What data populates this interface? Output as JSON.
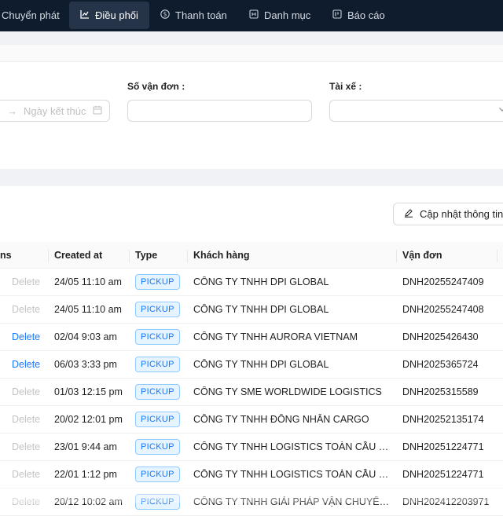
{
  "nav": {
    "items": [
      {
        "label": "Chuyển phát",
        "icon": "",
        "active": false
      },
      {
        "label": "Điều phối",
        "icon": "dispatch-chart-icon",
        "active": true
      },
      {
        "label": "Thanh toán",
        "icon": "dollar-icon",
        "active": false
      },
      {
        "label": "Danh mục",
        "icon": "catalog-icon",
        "active": false
      },
      {
        "label": "Báo cáo",
        "icon": "report-icon",
        "active": false
      }
    ]
  },
  "filters": {
    "date_end_placeholder": "Ngày kết thúc",
    "waybill_label": "Số vận đơn :",
    "driver_label": "Tài xế :"
  },
  "toolbar": {
    "update_label": "Cập nhật thông tin"
  },
  "table": {
    "headers": {
      "actions": "ns",
      "created_at": "Created at",
      "type": "Type",
      "customer": "Khách hàng",
      "waybill": "Vận đơn"
    },
    "delete_label": "Delete",
    "rows": [
      {
        "created_at": "24/05 11:10 am",
        "type": "PICKUP",
        "customer": "CÔNG TY TNHH DPI GLOBAL",
        "waybill": "DNH20255247409",
        "delete_enabled": false
      },
      {
        "created_at": "24/05 11:10 am",
        "type": "PICKUP",
        "customer": "CÔNG TY TNHH DPI GLOBAL",
        "waybill": "DNH20255247408",
        "delete_enabled": false
      },
      {
        "created_at": "02/04 9:03 am",
        "type": "PICKUP",
        "customer": "CÔNG TY TNHH AURORA VIETNAM",
        "waybill": "DNH2025426430",
        "delete_enabled": true
      },
      {
        "created_at": "06/03 3:33 pm",
        "type": "PICKUP",
        "customer": "CÔNG TY TNHH DPI GLOBAL",
        "waybill": "DNH2025365724",
        "delete_enabled": true
      },
      {
        "created_at": "01/03 12:15 pm",
        "type": "PICKUP",
        "customer": "CÔNG TY SME WORLDWIDE LOGISTICS",
        "waybill": "DNH2025315589",
        "delete_enabled": false
      },
      {
        "created_at": "20/02 12:01 pm",
        "type": "PICKUP",
        "customer": "CÔNG TY TNHH ĐÔNG NHÂN CARGO",
        "waybill": "DNH20252135174",
        "delete_enabled": false
      },
      {
        "created_at": "23/01 9:44 am",
        "type": "PICKUP",
        "customer": "CÔNG TY TNHH LOGISTICS TOÀN CẦU C...",
        "waybill": "DNH20251224771",
        "delete_enabled": false
      },
      {
        "created_at": "22/01 1:12 pm",
        "type": "PICKUP",
        "customer": "CÔNG TY TNHH LOGISTICS TOÀN CẦU C...",
        "waybill": "DNH20251224771",
        "delete_enabled": false
      },
      {
        "created_at": "20/12 10:02 am",
        "type": "PICKUP",
        "customer": "CÔNG TY TNHH GIẢI PHÁP VẬN CHUYỂN...",
        "waybill": "DNH202412203971",
        "delete_enabled": false
      }
    ]
  },
  "colors": {
    "nav_bg": "#0f1c2e",
    "accent": "#1677ff",
    "tag_bg": "#e6f4ff"
  }
}
